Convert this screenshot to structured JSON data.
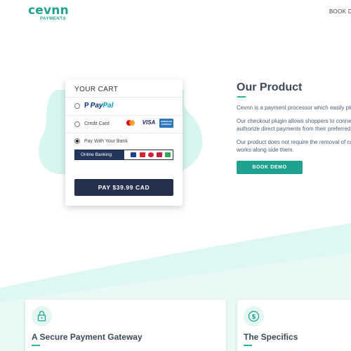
{
  "header": {
    "logo_main": "cevnn",
    "logo_sub": "PAYMENTS",
    "nav_link": "BOOK DE"
  },
  "cart": {
    "title": "YOUR CART",
    "options": [
      {
        "id": "paypal",
        "label_part1": "Pay",
        "label_part2": "Pal",
        "selected": false
      },
      {
        "id": "credit-card",
        "label": "Credit Card",
        "selected": false,
        "card_icons": [
          "mastercard-icon",
          "visa-icon",
          "amex-icon"
        ]
      },
      {
        "id": "bank",
        "label": "Pay With Your Bank",
        "selected": true
      }
    ],
    "visa_text": "VISA",
    "amex_text": "AMERICAN EXPRESS",
    "banking_label": "Online Banking",
    "bank_icons": [
      "bank-logo-1-icon",
      "bank-logo-2-icon",
      "bank-logo-3-icon",
      "bank-logo-4-icon",
      "bank-logo-5-icon"
    ],
    "pay_button": "PAY $39.99 CAD"
  },
  "product": {
    "title": "Our Product",
    "paragraphs": [
      [
        "Cevnn is a payment processor which easily plu"
      ],
      [
        "Our checkout plugin allows shoppers to conne",
        "authorize direct payments from their preferred"
      ],
      [
        "Our product does not require the removal of co",
        "works along side them."
      ]
    ],
    "button": "BOOK DEMO"
  },
  "features": [
    {
      "title": "A Secure Payment Gateway",
      "icon": "lock-icon"
    },
    {
      "title": "The Specifics",
      "icon": "dollar-icon"
    }
  ],
  "colors": {
    "brand": "#1fa38f",
    "navy": "#24304e",
    "heading": "#3b4a5a",
    "blob": "#d6f5ef"
  }
}
